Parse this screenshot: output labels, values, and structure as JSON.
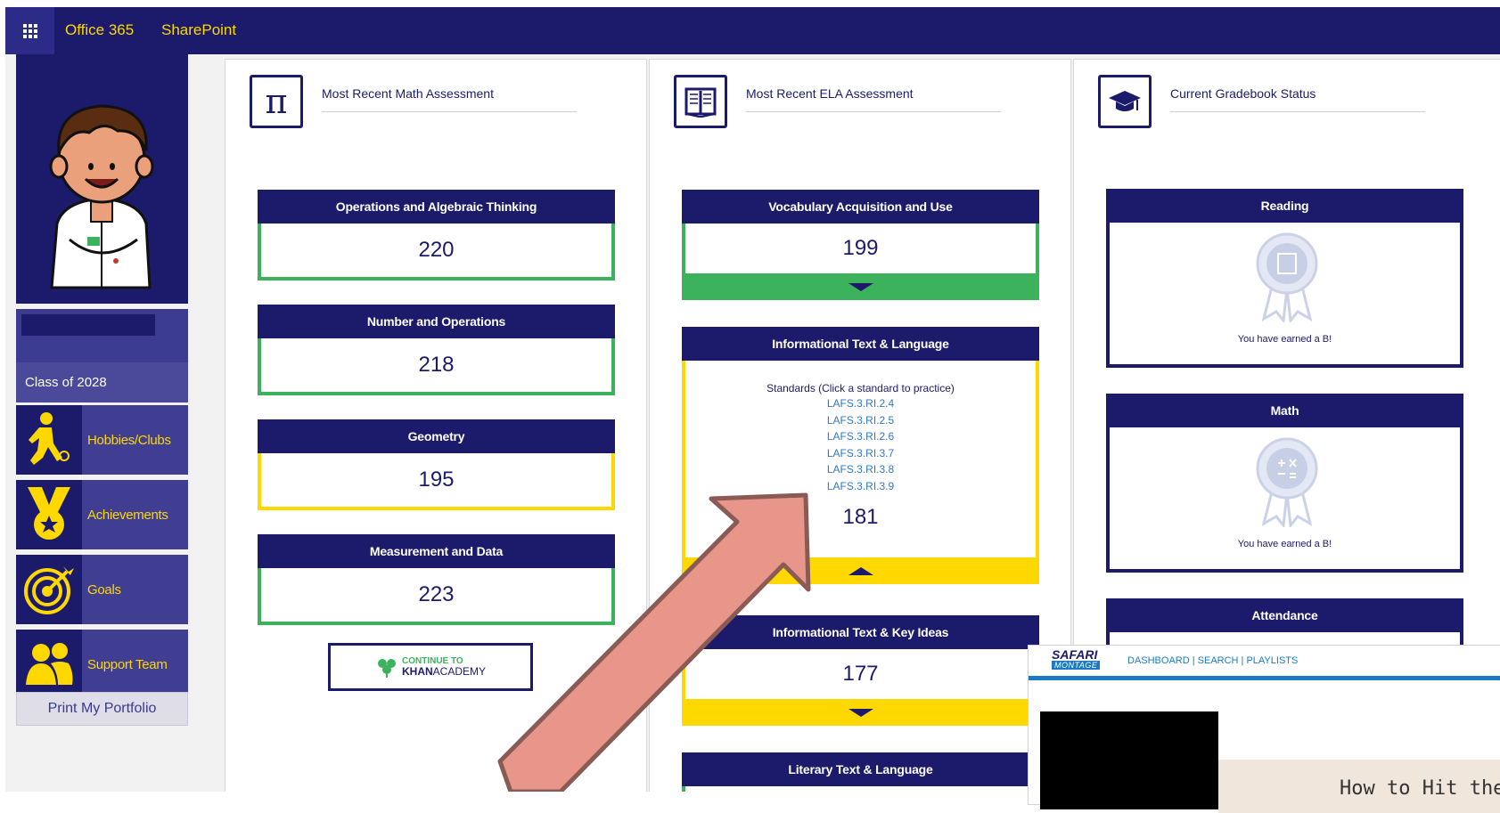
{
  "topbar": {
    "office_label": "Office 365",
    "sharepoint_label": "SharePoint"
  },
  "sidebar": {
    "class_label": "Class of 2028",
    "items": [
      {
        "label": "Hobbies/Clubs",
        "icon": "running-person-icon"
      },
      {
        "label": "Achievements",
        "icon": "medal-icon"
      },
      {
        "label": "Goals",
        "icon": "target-icon"
      },
      {
        "label": "Support Team",
        "icon": "people-icon"
      }
    ],
    "print_label": "Print My Portfolio"
  },
  "math": {
    "title": "Most Recent Math Assessment",
    "icon_glyph": "π",
    "cards": [
      {
        "label": "Operations and Algebraic Thinking",
        "score": "220",
        "status": "green"
      },
      {
        "label": "Number and Operations",
        "score": "218",
        "status": "green"
      },
      {
        "label": "Geometry",
        "score": "195",
        "status": "yellow"
      },
      {
        "label": "Measurement and Data",
        "score": "223",
        "status": "green"
      }
    ],
    "khan_top": "CONTINUE TO",
    "khan_bold": "KHAN",
    "khan_rest": "ACADEMY"
  },
  "ela": {
    "title": "Most Recent ELA Assessment",
    "cards": [
      {
        "label": "Vocabulary Acquisition and Use",
        "score": "199",
        "status": "green"
      },
      {
        "label": "Informational Text & Language",
        "score": "181",
        "status": "yellow"
      },
      {
        "label": "Informational Text & Key Ideas",
        "score": "177",
        "status": "yellow"
      },
      {
        "label": "Literary Text & Language",
        "status": "green"
      }
    ],
    "standards_title": "Standards (Click a standard to practice)",
    "standards": [
      "LAFS.3.RI.2.4",
      "LAFS.3.RI.2.5",
      "LAFS.3.RI.2.6",
      "LAFS.3.RI.3.7",
      "LAFS.3.RI.3.8",
      "LAFS.3.RI.3.9"
    ]
  },
  "gradebook": {
    "title": "Current Gradebook Status",
    "cards": [
      {
        "label": "Reading",
        "message": "You have earned a B!"
      },
      {
        "label": "Math",
        "message": "You have earned a B!"
      },
      {
        "label": "Attendance"
      }
    ]
  },
  "safari": {
    "logo_top": "SAFARI",
    "logo_bottom": "MONTAGE",
    "nav_links": "DASHBOARD | SEARCH | PLAYLISTS",
    "video_caption": "How to Hit the"
  },
  "colors": {
    "navy": "#1b1a6b",
    "green": "#3cb25c",
    "yellow": "#ffd800",
    "link": "#2f78c9",
    "arrow": "#e8968a"
  }
}
